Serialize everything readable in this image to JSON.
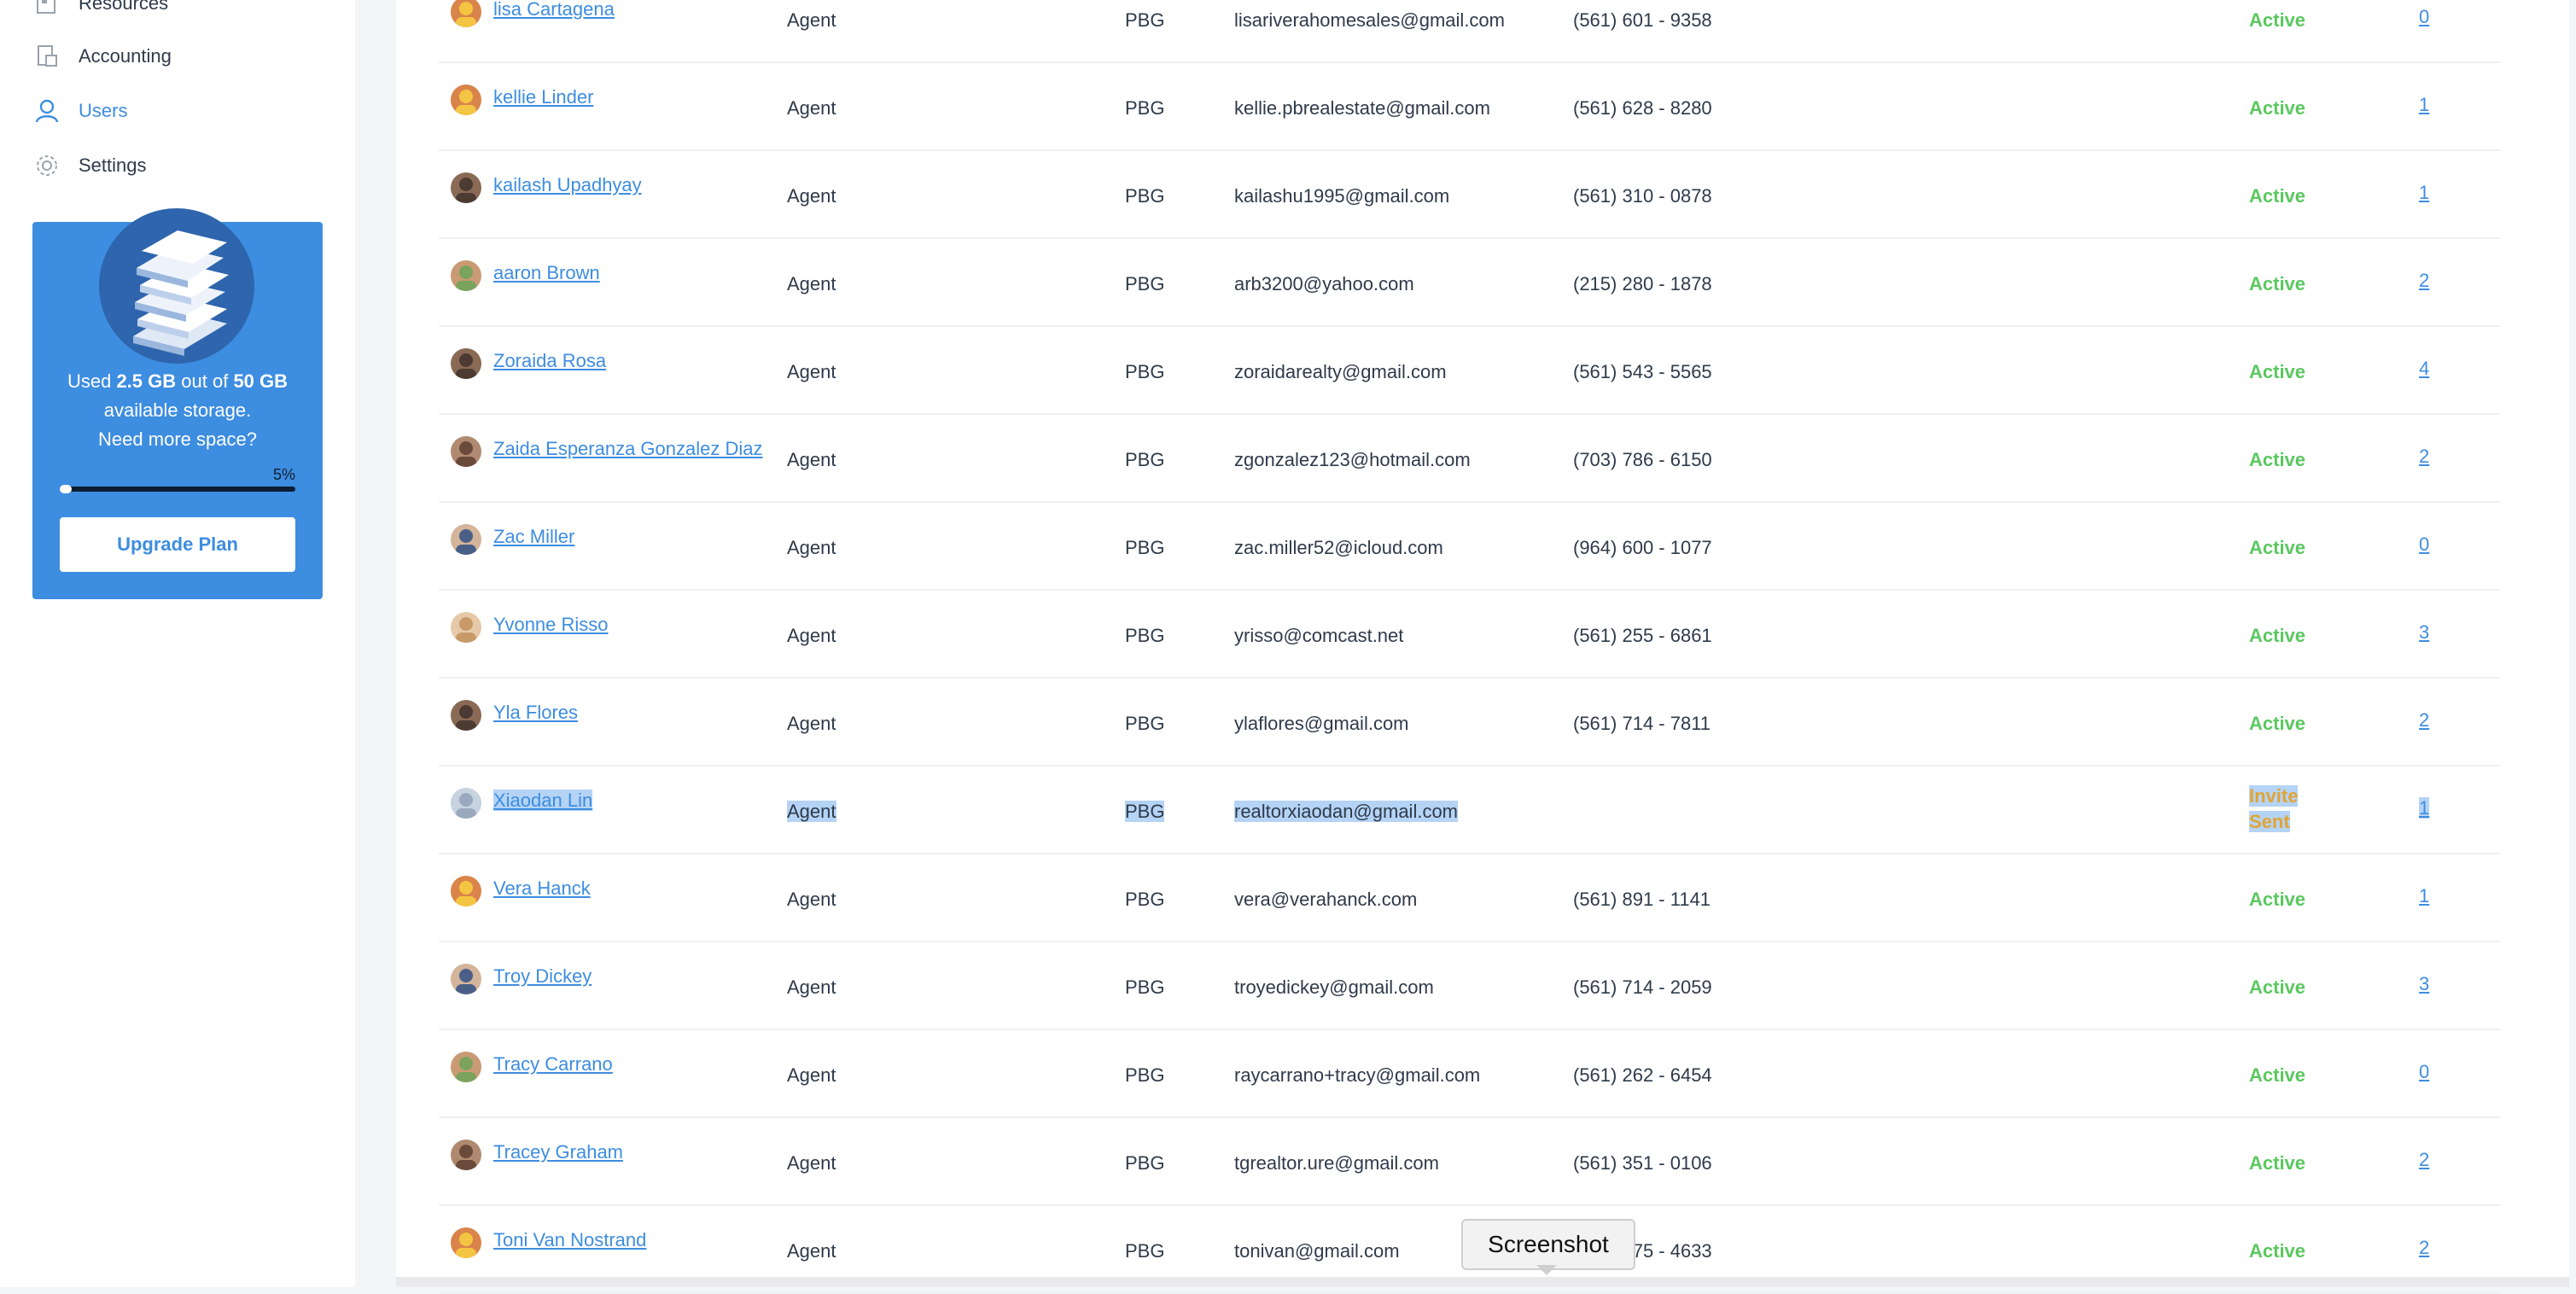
{
  "sidebar": {
    "items": [
      {
        "label": "Resources",
        "icon": "resources-icon"
      },
      {
        "label": "Accounting",
        "icon": "accounting-icon"
      },
      {
        "label": "Users",
        "icon": "user-icon"
      },
      {
        "label": "Settings",
        "icon": "gear-icon"
      }
    ],
    "active_item": "Users",
    "storage": {
      "used_prefix": "Used",
      "used": "2.5 GB",
      "out_of": "out of",
      "total": "50 GB",
      "line2": "available storage.",
      "line3": "Need more space?",
      "percent_label": "5%",
      "percent_value": 0.05,
      "upgrade_label": "Upgrade Plan"
    }
  },
  "users": [
    {
      "name": "lisa Cartagena",
      "role": "Agent",
      "office": "PBG",
      "email": "lisariverahomesales@gmail.com",
      "phone": "(561) 601 - 9358",
      "status": "Active",
      "count": "0",
      "avatar": "avatar-yellow"
    },
    {
      "name": "kellie Linder",
      "role": "Agent",
      "office": "PBG",
      "email": "kellie.pbrealestate@gmail.com",
      "phone": "(561) 628 - 8280",
      "status": "Active",
      "count": "1",
      "avatar": "avatar-yellow"
    },
    {
      "name": "kailash Upadhyay",
      "role": "Agent",
      "office": "PBG",
      "email": "kailashu1995@gmail.com",
      "phone": "(561) 310 - 0878",
      "status": "Active",
      "count": "1",
      "avatar": "avatar-dark"
    },
    {
      "name": "aaron Brown",
      "role": "Agent",
      "office": "PBG",
      "email": "arb3200@yahoo.com",
      "phone": "(215) 280 - 1878",
      "status": "Active",
      "count": "2",
      "avatar": "avatar-green"
    },
    {
      "name": "Zoraida Rosa",
      "role": "Agent",
      "office": "PBG",
      "email": "zoraidarealty@gmail.com",
      "phone": "(561) 543 - 5565",
      "status": "Active",
      "count": "4",
      "avatar": "avatar-dark"
    },
    {
      "name": "Zaida Esperanza Gonzalez Diaz",
      "role": "Agent",
      "office": "PBG",
      "email": "zgonzalez123@hotmail.com",
      "phone": "(703) 786 - 6150",
      "status": "Active",
      "count": "2",
      "avatar": "avatar-brown"
    },
    {
      "name": "Zac Miller",
      "role": "Agent",
      "office": "PBG",
      "email": "zac.miller52@icloud.com",
      "phone": "(964) 600 - 1077",
      "status": "Active",
      "count": "0",
      "avatar": "avatar-blue"
    },
    {
      "name": "Yvonne Risso",
      "role": "Agent",
      "office": "PBG",
      "email": "yrisso@comcast.net",
      "phone": "(561) 255 - 6861",
      "status": "Active",
      "count": "3",
      "avatar": "avatar-tan"
    },
    {
      "name": "Yla Flores",
      "role": "Agent",
      "office": "PBG",
      "email": "ylaflores@gmail.com",
      "phone": "(561) 714 - 7811",
      "status": "Active",
      "count": "2",
      "avatar": "avatar-dark"
    },
    {
      "name": "Xiaodan Lin",
      "role": "Agent",
      "office": "PBG",
      "email": "realtorxiaodan@gmail.com",
      "phone": "",
      "status": "Invite Sent",
      "count": "1",
      "avatar": "avatar-grey",
      "selected": true
    },
    {
      "name": "Vera Hanck",
      "role": "Agent",
      "office": "PBG",
      "email": "vera@verahanck.com",
      "phone": "(561) 891 - 1141",
      "status": "Active",
      "count": "1",
      "avatar": "avatar-yellow"
    },
    {
      "name": "Troy Dickey",
      "role": "Agent",
      "office": "PBG",
      "email": "troyedickey@gmail.com",
      "phone": "(561) 714 - 2059",
      "status": "Active",
      "count": "3",
      "avatar": "avatar-blue"
    },
    {
      "name": "Tracy Carrano",
      "role": "Agent",
      "office": "PBG",
      "email": "raycarrano+tracy@gmail.com",
      "phone": "(561) 262 - 6454",
      "status": "Active",
      "count": "0",
      "avatar": "avatar-green"
    },
    {
      "name": "Tracey Graham",
      "role": "Agent",
      "office": "PBG",
      "email": "tgrealtor.ure@gmail.com",
      "phone": "(561) 351 - 0106",
      "status": "Active",
      "count": "2",
      "avatar": "avatar-brown"
    },
    {
      "name": "Toni Van Nostrand",
      "role": "Agent",
      "office": "PBG",
      "email": "tonivan@gmail.com",
      "phone": "(561) 275 - 4633",
      "status": "Active",
      "count": "2",
      "avatar": "avatar-yellow"
    }
  ],
  "tooltip": {
    "label": "Screenshot"
  },
  "colors": {
    "accent": "#3d8de0",
    "active": "#5ac85f",
    "invite": "#e2a432",
    "selection": "#b4d3f5"
  }
}
